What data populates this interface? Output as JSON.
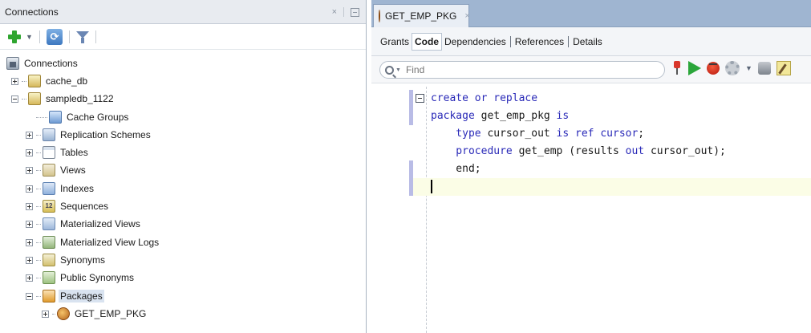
{
  "connections_panel": {
    "title": "Connections",
    "close_glyph": "×",
    "toolbar": {
      "icons": [
        "add-connection-icon",
        "dropdown-caret-icon",
        "refresh-icon",
        "filter-icon"
      ]
    },
    "tree": [
      {
        "label": "Connections",
        "icon": "connections-root-icon",
        "expander": "none"
      },
      {
        "label": "cache_db",
        "icon": "connection-icon",
        "expander": "plus"
      },
      {
        "label": "sampledb_1122",
        "icon": "connection-icon",
        "expander": "minus"
      },
      {
        "label": "Cache Groups",
        "icon": "cache-groups-icon",
        "expander": "none"
      },
      {
        "label": "Replication Schemes",
        "icon": "replication-icon",
        "expander": "plus"
      },
      {
        "label": "Tables",
        "icon": "tables-icon",
        "expander": "plus"
      },
      {
        "label": "Views",
        "icon": "views-icon",
        "expander": "plus"
      },
      {
        "label": "Indexes",
        "icon": "indexes-icon",
        "expander": "plus"
      },
      {
        "label": "Sequences",
        "icon": "sequences-icon",
        "expander": "plus"
      },
      {
        "label": "Materialized Views",
        "icon": "materialized-views-icon",
        "expander": "plus"
      },
      {
        "label": "Materialized View Logs",
        "icon": "materialized-view-logs-icon",
        "expander": "plus"
      },
      {
        "label": "Synonyms",
        "icon": "synonyms-icon",
        "expander": "plus"
      },
      {
        "label": "Public Synonyms",
        "icon": "public-synonyms-icon",
        "expander": "plus"
      },
      {
        "label": "Packages",
        "icon": "packages-icon",
        "expander": "minus",
        "selected": true
      },
      {
        "label": "GET_EMP_PKG",
        "icon": "package-icon",
        "expander": "plus"
      }
    ],
    "sequence_icon_text": "12"
  },
  "editor": {
    "tab": {
      "label": "GET_EMP_PKG",
      "close_glyph": "×"
    },
    "sub_tabs": [
      {
        "label": "Grants",
        "active": false
      },
      {
        "label": "Code",
        "active": true
      },
      {
        "label": "Dependencies",
        "active": false
      },
      {
        "label": "References",
        "active": false
      },
      {
        "label": "Details",
        "active": false
      }
    ],
    "find": {
      "placeholder": "Find",
      "value": ""
    },
    "toolbar_icons": [
      "pin-icon",
      "run-icon",
      "debug-icon",
      "settings-icon",
      "dropdown-caret-icon",
      "compile-icon",
      "edit-icon"
    ],
    "code_lines": [
      [
        {
          "t": "create or replace",
          "k": true
        }
      ],
      [
        {
          "t": "package",
          "k": true
        },
        {
          "t": " get_emp_pkg ",
          "k": false
        },
        {
          "t": "is",
          "k": true
        }
      ],
      [
        {
          "t": "    type",
          "k": true
        },
        {
          "t": " cursor_out ",
          "k": false
        },
        {
          "t": "is ref cursor",
          "k": true
        },
        {
          "t": ";",
          "k": false
        }
      ],
      [
        {
          "t": "    procedure",
          "k": true
        },
        {
          "t": " get_emp (results ",
          "k": false
        },
        {
          "t": "out",
          "k": true
        },
        {
          "t": " cursor_out);",
          "k": false
        }
      ],
      [
        {
          "t": "    end;",
          "k": false
        }
      ],
      []
    ],
    "current_line": 6
  },
  "colors": {
    "keyword": "#2a2ab8",
    "tab_strip": "#9fb5d1",
    "current_line_highlight": "#fbfde6",
    "change_bar": "#b9bce6"
  }
}
